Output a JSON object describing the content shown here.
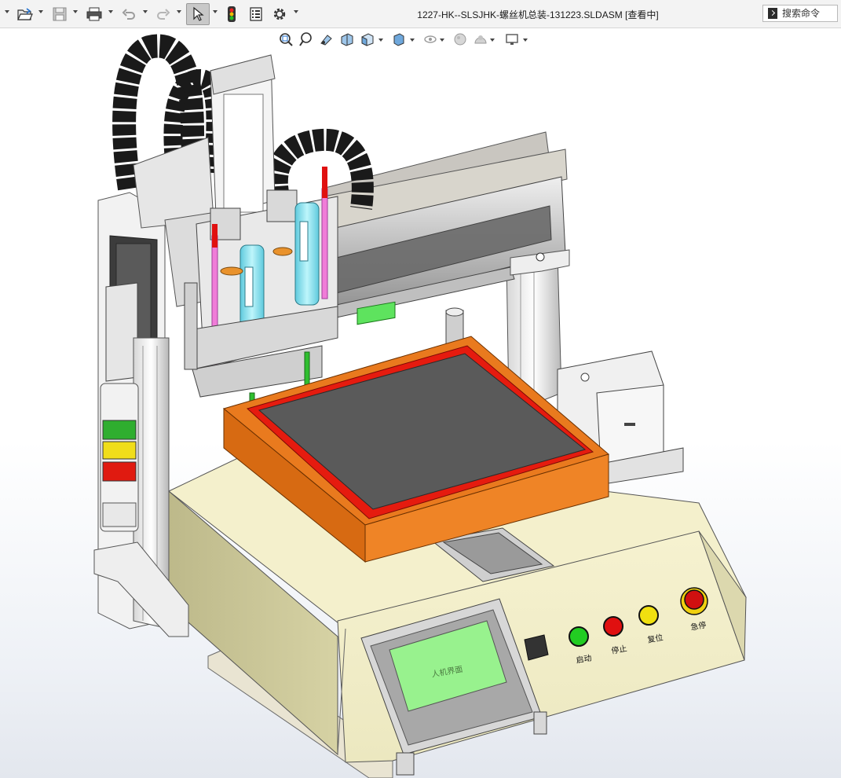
{
  "app": {
    "document_title": "1227-HK--SLSJHK-螺丝机总装-131223.SLDASM [查看中]"
  },
  "search": {
    "placeholder": "搜索命令"
  },
  "toolbar": {
    "items": [
      {
        "icon": "open-folder-icon"
      },
      {
        "icon": "save-icon"
      },
      {
        "icon": "print-icon"
      },
      {
        "icon": "undo-icon"
      },
      {
        "icon": "redo-icon"
      },
      {
        "icon": "select-arrow-icon",
        "active": true
      },
      {
        "icon": "traffic-light-icon"
      },
      {
        "icon": "file-properties-icon"
      },
      {
        "icon": "gear-icon"
      }
    ]
  },
  "view_toolbar": {
    "items": [
      {
        "icon": "zoom-to-fit-icon"
      },
      {
        "icon": "zoom-to-area-icon"
      },
      {
        "icon": "previous-view-icon"
      },
      {
        "icon": "section-view-icon"
      },
      {
        "icon": "view-orientation-icon"
      },
      {
        "icon": "display-style-icon"
      },
      {
        "icon": "hide-show-items-icon"
      },
      {
        "icon": "edit-appearance-icon"
      },
      {
        "icon": "apply-scene-icon"
      },
      {
        "icon": "view-settings-icon"
      }
    ]
  },
  "machine": {
    "hmi_screen_text": "人机界面",
    "buttons": {
      "start": "启动",
      "stop": "停止",
      "reset": "复位",
      "estop": "急停"
    },
    "colors": {
      "base": "#f2efc9",
      "base_dark": "#bcb88a",
      "plate": "#5a5a5a",
      "fixture_orange": "#e97a1e",
      "fixture_red": "#e51b0f",
      "hmi_screen": "#98f28e",
      "start_button": "#22cc22",
      "stop_button": "#e01010",
      "reset_button": "#f0e010",
      "estop_button": "#d01010",
      "cyan_cylinder": "#8fe6f0",
      "pink_rod": "#f07cd8",
      "green_rod": "#2fbf2f",
      "cable_chain": "#1a1a1a"
    }
  }
}
